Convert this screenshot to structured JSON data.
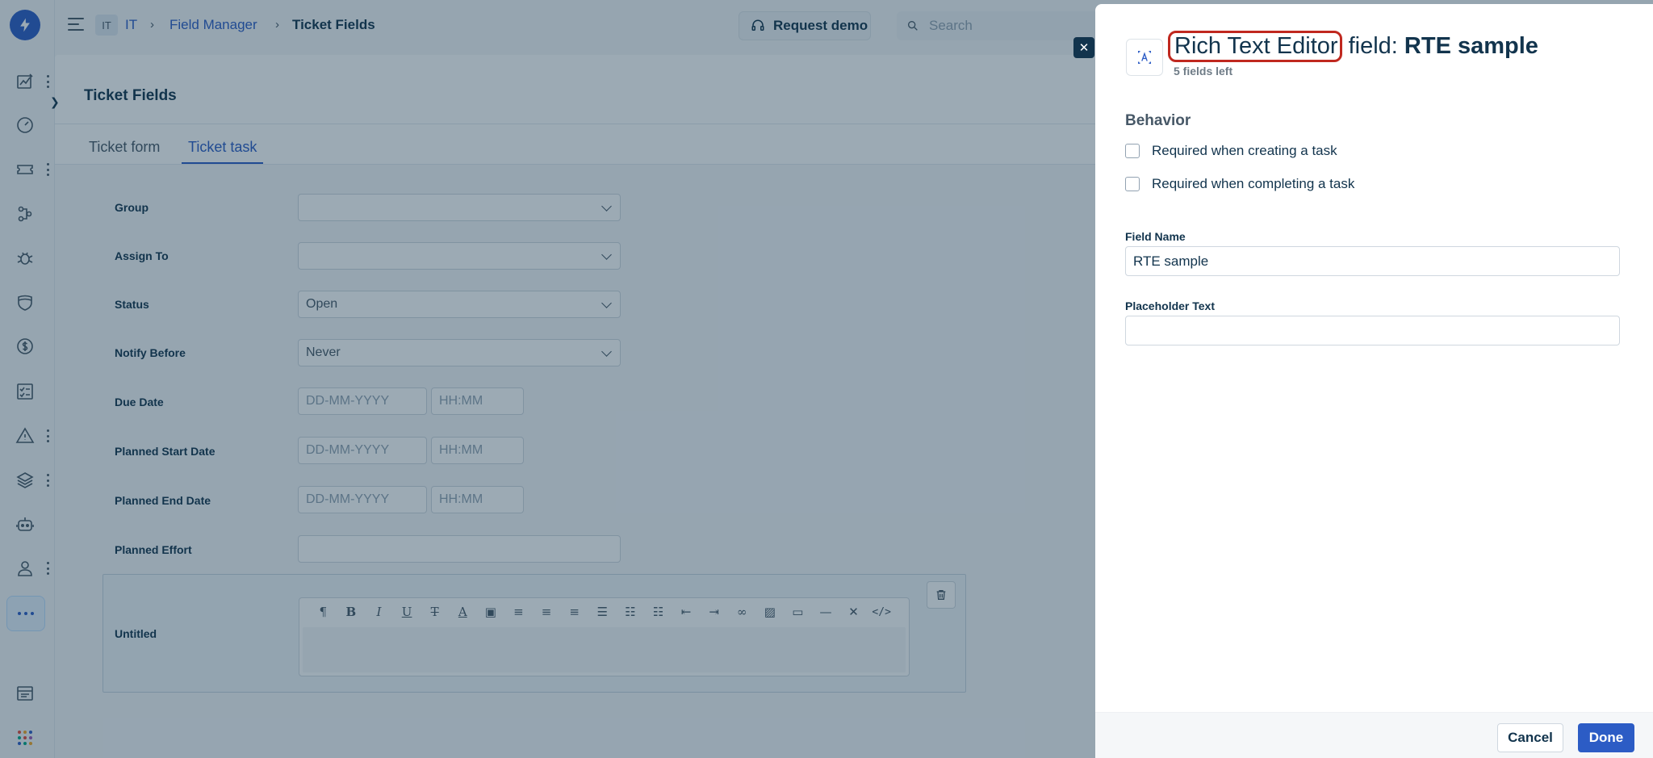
{
  "header": {
    "workspace_badge": "IT",
    "breadcrumbs": [
      "IT",
      "Field Manager",
      "Ticket Fields"
    ],
    "request_demo_label": "Request demo",
    "search_placeholder": "Search"
  },
  "rail": {
    "icons": [
      "dashboard-icon",
      "speedometer-icon",
      "ticket-icon",
      "workflow-icon",
      "bug-icon",
      "shield-icon",
      "dollar-icon",
      "checklist-icon",
      "alert-icon",
      "layers-icon",
      "bot-icon",
      "contacts-icon",
      "more-icon",
      "report-icon",
      "apps-icon"
    ]
  },
  "page": {
    "title": "Ticket Fields",
    "tabs": [
      {
        "label": "Ticket form",
        "active": false
      },
      {
        "label": "Ticket task",
        "active": true
      }
    ]
  },
  "form": {
    "group": {
      "label": "Group",
      "value": ""
    },
    "assign_to": {
      "label": "Assign To",
      "value": ""
    },
    "status": {
      "label": "Status",
      "value": "Open"
    },
    "notify_before": {
      "label": "Notify Before",
      "value": "Never"
    },
    "due_date": {
      "label": "Due Date",
      "date_placeholder": "DD-MM-YYYY",
      "time_placeholder": "HH:MM"
    },
    "planned_start": {
      "label": "Planned Start Date",
      "date_placeholder": "DD-MM-YYYY",
      "time_placeholder": "HH:MM"
    },
    "planned_end": {
      "label": "Planned End Date",
      "date_placeholder": "DD-MM-YYYY",
      "time_placeholder": "HH:MM"
    },
    "planned_effort": {
      "label": "Planned Effort",
      "value": ""
    },
    "rte": {
      "label": "Untitled",
      "toolbar": [
        "paragraph-icon",
        "bold-icon",
        "italic-icon",
        "underline-icon",
        "strikethrough-icon",
        "font-color-icon",
        "highlight-icon",
        "align-left-icon",
        "align-center-icon",
        "align-right-icon",
        "justify-icon",
        "bullet-list-icon",
        "numbered-list-icon",
        "outdent-icon",
        "indent-icon",
        "link-icon",
        "image-icon",
        "table-icon",
        "horizontal-rule-icon",
        "clear-format-icon",
        "code-icon"
      ]
    }
  },
  "drawer": {
    "type_label": "Rich Text Editor",
    "title_middle": " field: ",
    "field_title": "RTE sample",
    "fields_left": "5 fields left",
    "behavior_title": "Behavior",
    "checkboxes": [
      {
        "label": "Required when creating a task",
        "checked": false
      },
      {
        "label": "Required when completing a task",
        "checked": false
      }
    ],
    "field_name_label": "Field Name",
    "field_name_value": "RTE sample",
    "placeholder_label": "Placeholder Text",
    "placeholder_value": "",
    "cancel_label": "Cancel",
    "done_label": "Done"
  },
  "colors": {
    "brand": "#2c5cc5",
    "highlight_ring": "#c0281f",
    "text": "#12344d"
  }
}
